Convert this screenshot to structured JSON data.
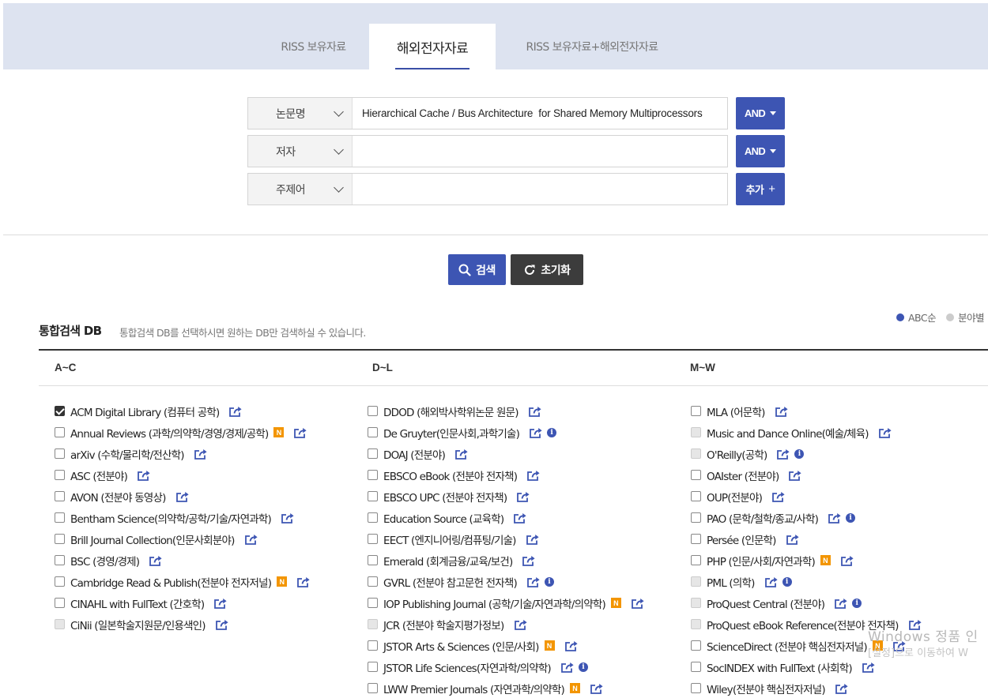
{
  "tabs": [
    {
      "label": "RISS 보유자료",
      "active": false
    },
    {
      "label": "해외전자자료",
      "active": true
    },
    {
      "label": "RISS 보유자료+해외전자자료",
      "active": false
    }
  ],
  "search_rows": [
    {
      "field": "논문명",
      "value": "Hierarchical Cache / Bus Architecture  for Shared Memory Multiprocessors",
      "operator": "AND"
    },
    {
      "field": "저자",
      "value": "",
      "operator": "AND"
    },
    {
      "field": "주제어",
      "value": "",
      "operator": "추가"
    }
  ],
  "actions": {
    "search": "검색",
    "reset": "초기화"
  },
  "db_section": {
    "title": "통합검색 DB",
    "description": "통합검색 DB를 선택하시면 원하는 DB만 검색하실 수 있습니다.",
    "sort_options": [
      "ABC순",
      "분야별"
    ],
    "columns": [
      "A~C",
      "D~L",
      "M~W"
    ]
  },
  "databases": {
    "col_a": [
      {
        "name": "ACM Digital Library (컴퓨터 공학)",
        "state": "checked",
        "new": false,
        "info": false
      },
      {
        "name": "Annual Reviews (과학/의약학/경영/경제/공학)",
        "state": "unchecked",
        "new": true,
        "info": false
      },
      {
        "name": "arXiv (수학/물리학/전산학)",
        "state": "unchecked",
        "new": false,
        "info": false
      },
      {
        "name": "ASC (전분야)",
        "state": "unchecked",
        "new": false,
        "info": false
      },
      {
        "name": "AVON (전분야 동영상)",
        "state": "unchecked",
        "new": false,
        "info": false
      },
      {
        "name": "Bentham Science(의약학/공학/기술/자연과학)",
        "state": "unchecked",
        "new": false,
        "info": false
      },
      {
        "name": "Brill Journal Collection(인문사회분야)",
        "state": "unchecked",
        "new": false,
        "info": false
      },
      {
        "name": "BSC (경영/경제)",
        "state": "unchecked",
        "new": false,
        "info": false
      },
      {
        "name": "Cambridge Read & Publish(전분야 전자저널)",
        "state": "unchecked",
        "new": true,
        "info": false
      },
      {
        "name": "CINAHL with FullText (간호학)",
        "state": "unchecked",
        "new": false,
        "info": false
      },
      {
        "name": "CiNii (일본학술지원문/인용색인)",
        "state": "disabled",
        "new": false,
        "info": false
      }
    ],
    "col_b": [
      {
        "name": "DDOD (해외박사학위논문 원문)",
        "state": "unchecked",
        "new": false,
        "info": false
      },
      {
        "name": "De Gruyter(인문사회,과학기술)",
        "state": "unchecked",
        "new": false,
        "info": true
      },
      {
        "name": "DOAJ (전분야)",
        "state": "unchecked",
        "new": false,
        "info": false
      },
      {
        "name": "EBSCO eBook (전분야 전자책)",
        "state": "unchecked",
        "new": false,
        "info": false
      },
      {
        "name": "EBSCO UPC (전분야 전자책)",
        "state": "unchecked",
        "new": false,
        "info": false
      },
      {
        "name": "Education Source (교육학)",
        "state": "unchecked",
        "new": false,
        "info": false
      },
      {
        "name": "EECT (엔지니어링/컴퓨팅/기술)",
        "state": "unchecked",
        "new": false,
        "info": false
      },
      {
        "name": "Emerald (회계금융/교육/보건)",
        "state": "unchecked",
        "new": false,
        "info": false
      },
      {
        "name": "GVRL (전분야 참고문헌 전자책)",
        "state": "unchecked",
        "new": false,
        "info": true
      },
      {
        "name": "IOP Publishing Journal (공학/기술/자연과학/의약학)",
        "state": "unchecked",
        "new": true,
        "info": false
      },
      {
        "name": "JCR (전분야 학술지평가정보)",
        "state": "disabled",
        "new": false,
        "info": false
      },
      {
        "name": "JSTOR Arts & Sciences (인문/사회)",
        "state": "unchecked",
        "new": true,
        "info": false
      },
      {
        "name": "JSTOR Life Sciences(자연과학/의약학)",
        "state": "unchecked",
        "new": false,
        "info": true
      },
      {
        "name": "LWW Premier Journals (자연과학/의약학)",
        "state": "unchecked",
        "new": true,
        "info": false
      }
    ],
    "col_c": [
      {
        "name": "MLA (어문학)",
        "state": "unchecked",
        "new": false,
        "info": false
      },
      {
        "name": "Music and Dance Online(예술/체육)",
        "state": "disabled",
        "new": false,
        "info": false
      },
      {
        "name": "O'Reilly(공학)",
        "state": "disabled",
        "new": false,
        "info": true
      },
      {
        "name": "OAIster (전분야)",
        "state": "unchecked",
        "new": false,
        "info": false
      },
      {
        "name": "OUP(전분야)",
        "state": "unchecked",
        "new": false,
        "info": false
      },
      {
        "name": "PAO (문학/철학/종교/사학)",
        "state": "unchecked",
        "new": false,
        "info": true
      },
      {
        "name": "Persée (인문학)",
        "state": "unchecked",
        "new": false,
        "info": false
      },
      {
        "name": "PHP (인문/사회/자연과학)",
        "state": "unchecked",
        "new": true,
        "info": false
      },
      {
        "name": "PML (의학)",
        "state": "disabled",
        "new": false,
        "info": true
      },
      {
        "name": "ProQuest Central (전분야)",
        "state": "disabled",
        "new": false,
        "info": true
      },
      {
        "name": "ProQuest eBook Reference(전분야 전자책)",
        "state": "disabled",
        "new": false,
        "info": false
      },
      {
        "name": "ScienceDirect (전분야 핵심전자저널)",
        "state": "unchecked",
        "new": true,
        "info": false
      },
      {
        "name": "SocINDEX with FullText (사회학)",
        "state": "unchecked",
        "new": false,
        "info": false
      },
      {
        "name": "Wiley(전분야 핵심전자저널)",
        "state": "unchecked",
        "new": false,
        "info": false
      }
    ]
  },
  "badge_text": "N",
  "info_text": "i",
  "watermark": {
    "line1": "Windows 정품 인",
    "line2": "[설정]으로 이동하여 W"
  },
  "colors": {
    "accent": "#3d55b3",
    "tab_band": "#dde3f0",
    "new_badge": "#f39500",
    "reset_button": "#3c3c3c"
  }
}
